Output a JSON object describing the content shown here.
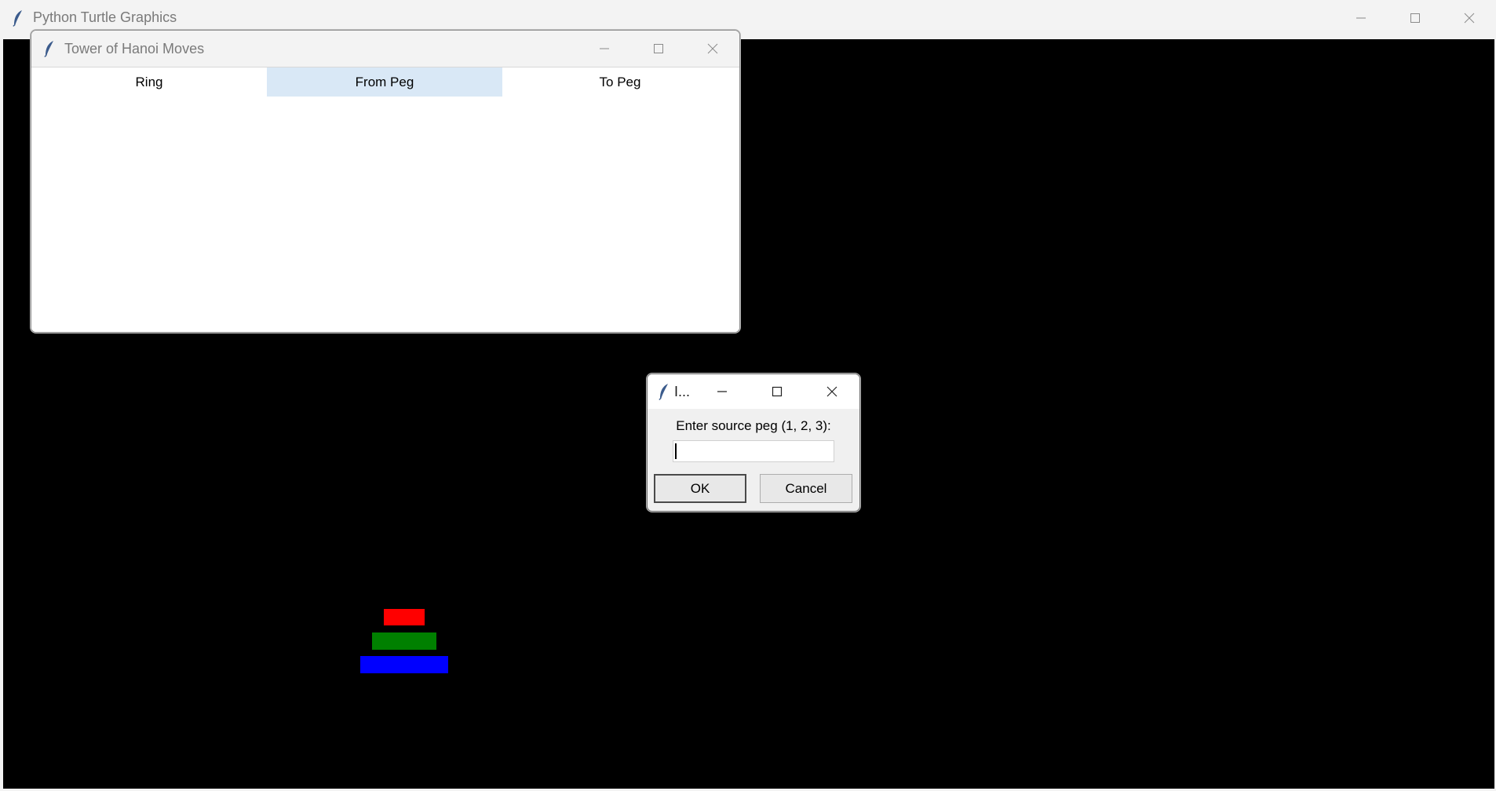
{
  "main_window": {
    "title": "Python Turtle Graphics"
  },
  "moves_window": {
    "title": "Tower of Hanoi Moves",
    "columns": [
      "Ring",
      "From Peg",
      "To Peg"
    ],
    "rows": []
  },
  "dialog": {
    "title": "I...",
    "prompt": "Enter source peg (1, 2, 3):",
    "entry_value": "",
    "ok_label": "OK",
    "cancel_label": "Cancel"
  },
  "rings": [
    {
      "color": "#ff0000",
      "level": "top"
    },
    {
      "color": "#008000",
      "level": "middle"
    },
    {
      "color": "#0000ff",
      "level": "bottom"
    }
  ],
  "colors": {
    "canvas_background": "#000000",
    "header_highlight": "#d9e8f6"
  },
  "icons": {
    "app": "feather-icon",
    "minimize": "minimize-icon",
    "maximize": "maximize-icon",
    "close": "close-icon"
  }
}
